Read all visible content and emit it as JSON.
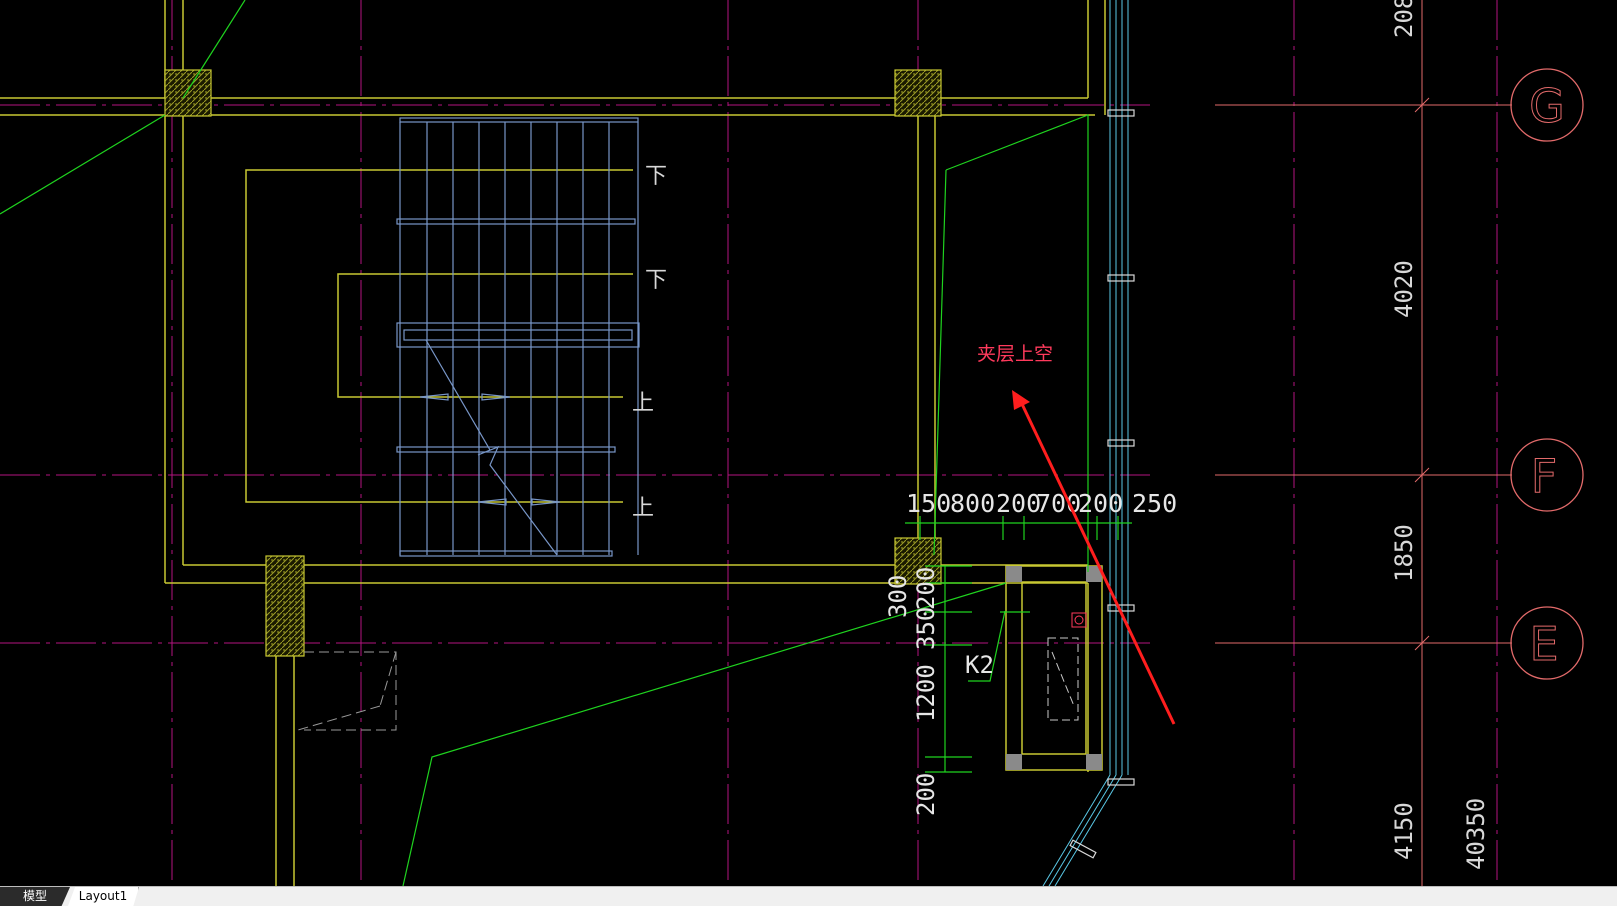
{
  "drawing": {
    "annotation": "夹层上空",
    "stair_labels": {
      "down_1": "下",
      "down_2": "下",
      "up_1": "上",
      "up_2": "上"
    },
    "dimensions_horizontal": [
      "150",
      "800",
      "200",
      "700",
      "200",
      "250"
    ],
    "dimensions_vertical_left": [
      "300",
      "200",
      "350",
      "1200",
      "200"
    ],
    "dimensions_right": [
      "208",
      "4020",
      "1850",
      "4150",
      "40350"
    ],
    "tag": "K2",
    "grid_bubbles": [
      "G",
      "F",
      "E"
    ]
  },
  "colors": {
    "background": "#000000",
    "wall": "#c8c832",
    "grid_line": "#b4147f",
    "grid_bubble": "#e26a6a",
    "stair": "#7896c8",
    "dimension": "#1fd31f",
    "annotation_text": "#ff3a5c",
    "arrow": "#ff1e1e",
    "glass": "#5ac8e6",
    "dimension_text": "#e6e6e6"
  },
  "tabs": [
    {
      "label": "模型",
      "active": true
    },
    {
      "label": "Layout1",
      "active": false
    }
  ]
}
